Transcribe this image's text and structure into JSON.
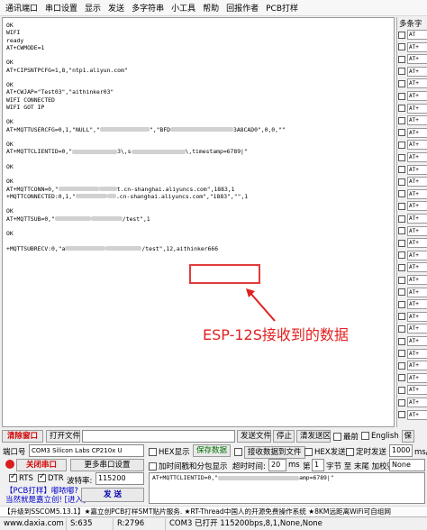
{
  "menu": [
    "通讯端口",
    "串口设置",
    "显示",
    "发送",
    "多字符串",
    "小工具",
    "帮助",
    "回报作者",
    "PCB打样"
  ],
  "terminal": {
    "lines": [
      {
        "t": "OK"
      },
      {
        "t": "WIFI"
      },
      {
        "t": "ready"
      },
      {
        "t": "AT+CWMODE=1"
      },
      {
        "t": ""
      },
      {
        "t": "OK"
      },
      {
        "t": "AT+CIPSNTPCFG=1,8,\"ntp1.aliyun.com\""
      },
      {
        "t": ""
      },
      {
        "t": "OK"
      },
      {
        "t": "AT+CWJAP=\"Test03\",\"aithinker03\""
      },
      {
        "t": "WIFI CONNECTED"
      },
      {
        "t": "WIFI GOT IP"
      },
      {
        "t": ""
      },
      {
        "t": "OK"
      },
      {
        "t": "AT+MQTTUSERCFG=0,1,\"NULL\",\"",
        "b1": 55,
        "m": "\",\"BFD",
        "b2": 70,
        "e": "3A8CAD0\",0,0,\"\""
      },
      {
        "t": ""
      },
      {
        "t": "OK"
      },
      {
        "t": "AT+MQTTCLIENTID=0,\"",
        "b1": 50,
        "m": "3\\,s",
        "b2": 60,
        "e": "\\,timestamp=6789|\""
      },
      {
        "t": ""
      },
      {
        "t": "OK"
      },
      {
        "t": ""
      },
      {
        "t": "OK"
      },
      {
        "t": "AT+MQTTCONN=0,\"",
        "b1": 45,
        "m": "",
        "b2": 20,
        "e": "t.cn-shanghai.aliyuncs.com\",1883,1"
      },
      {
        "t": "+MQTTCONNECTED:0,1,\"",
        "b1": 35,
        "m": "",
        "b2": 10,
        "e": ".cn-shanghai.aliyuncs.com\",\"1883\",\"\",1"
      },
      {
        "t": ""
      },
      {
        "t": "OK"
      },
      {
        "t": "AT+MQTTSUB=0,\"",
        "b1": 40,
        "m": "",
        "b2": 35,
        "e": "/test\",1"
      },
      {
        "t": ""
      },
      {
        "t": "OK"
      },
      {
        "t": ""
      },
      {
        "t": "+MQTTSUBRECV:0,\"a",
        "b1": 45,
        "m": "",
        "b2": 40,
        "e": "/test\",12,aithinker666"
      }
    ],
    "annotation": "ESP-12S接收到的数据"
  },
  "right_panel": {
    "title": "多条字",
    "rows": [
      "AT",
      "AT+",
      "AT+",
      "AT+",
      "AT+",
      "AT+",
      "AT+",
      "AT+",
      "AT+",
      "AT+",
      "AT+",
      "AT+",
      "AT+",
      "AT+",
      "AT+",
      "AT+",
      "AT+",
      "AT+",
      "AT+",
      "AT+",
      "AT+",
      "AT+",
      "AT+",
      "AT+",
      "AT+",
      "AT+",
      "AT+",
      "AT+",
      "AT+",
      "AT+",
      "AT+",
      "AT+"
    ]
  },
  "toolbar1": {
    "clear_window": "清除窗口",
    "open_file": "打开文件",
    "send_file": "发送文件",
    "stop": "停止",
    "clear_send": "清发送区",
    "topmost": "最前",
    "english": "English",
    "save": "保"
  },
  "controls": {
    "port_label": "端口号",
    "port_value": "COM3 Silicon Labs CP210x U",
    "hex_display": "HEX显示",
    "save_data": "保存数据",
    "recv_to_file": "接收数据到文件",
    "hex_send": "HEX发送",
    "timed_send": "定时发送",
    "timed_value": "1000",
    "timed_unit": "ms/次",
    "close_port": "关闭串口",
    "more_settings": "更多串口设置",
    "add_timestamp": "加时间戳和分包显示",
    "timeout_label": "超时时间:",
    "timeout_value": "20",
    "timeout_unit": "ms",
    "page_label": "第",
    "page_value": "1",
    "byte_label": "字节 至 末尾 加校验",
    "checksum": "None",
    "rts": "RTS",
    "dtr": "DTR",
    "baud_label": "波特率:",
    "baud_value": "115200",
    "send_btn": "发 送",
    "send_text": "AT+MQTTCLIENTID=0,\"",
    "send_text_end": "amp=6789|\""
  },
  "promo": {
    "line1": "【PCB打样】嘟哝嘟?",
    "line2": "当然就是嘉立创! [进入]"
  },
  "ticker": "【升级到SSCOM5.13.1】★嘉立创PCB打样SMT贴片服务. ★RT-Thread中国人的开源免费操作系统 ★8KM远距离WiFi可自组网",
  "status": {
    "site": "www.daxia.com",
    "s": "S:635",
    "r": "R:2796",
    "port_state": "COM3 已打开  115200bps,8,1,None,None"
  }
}
